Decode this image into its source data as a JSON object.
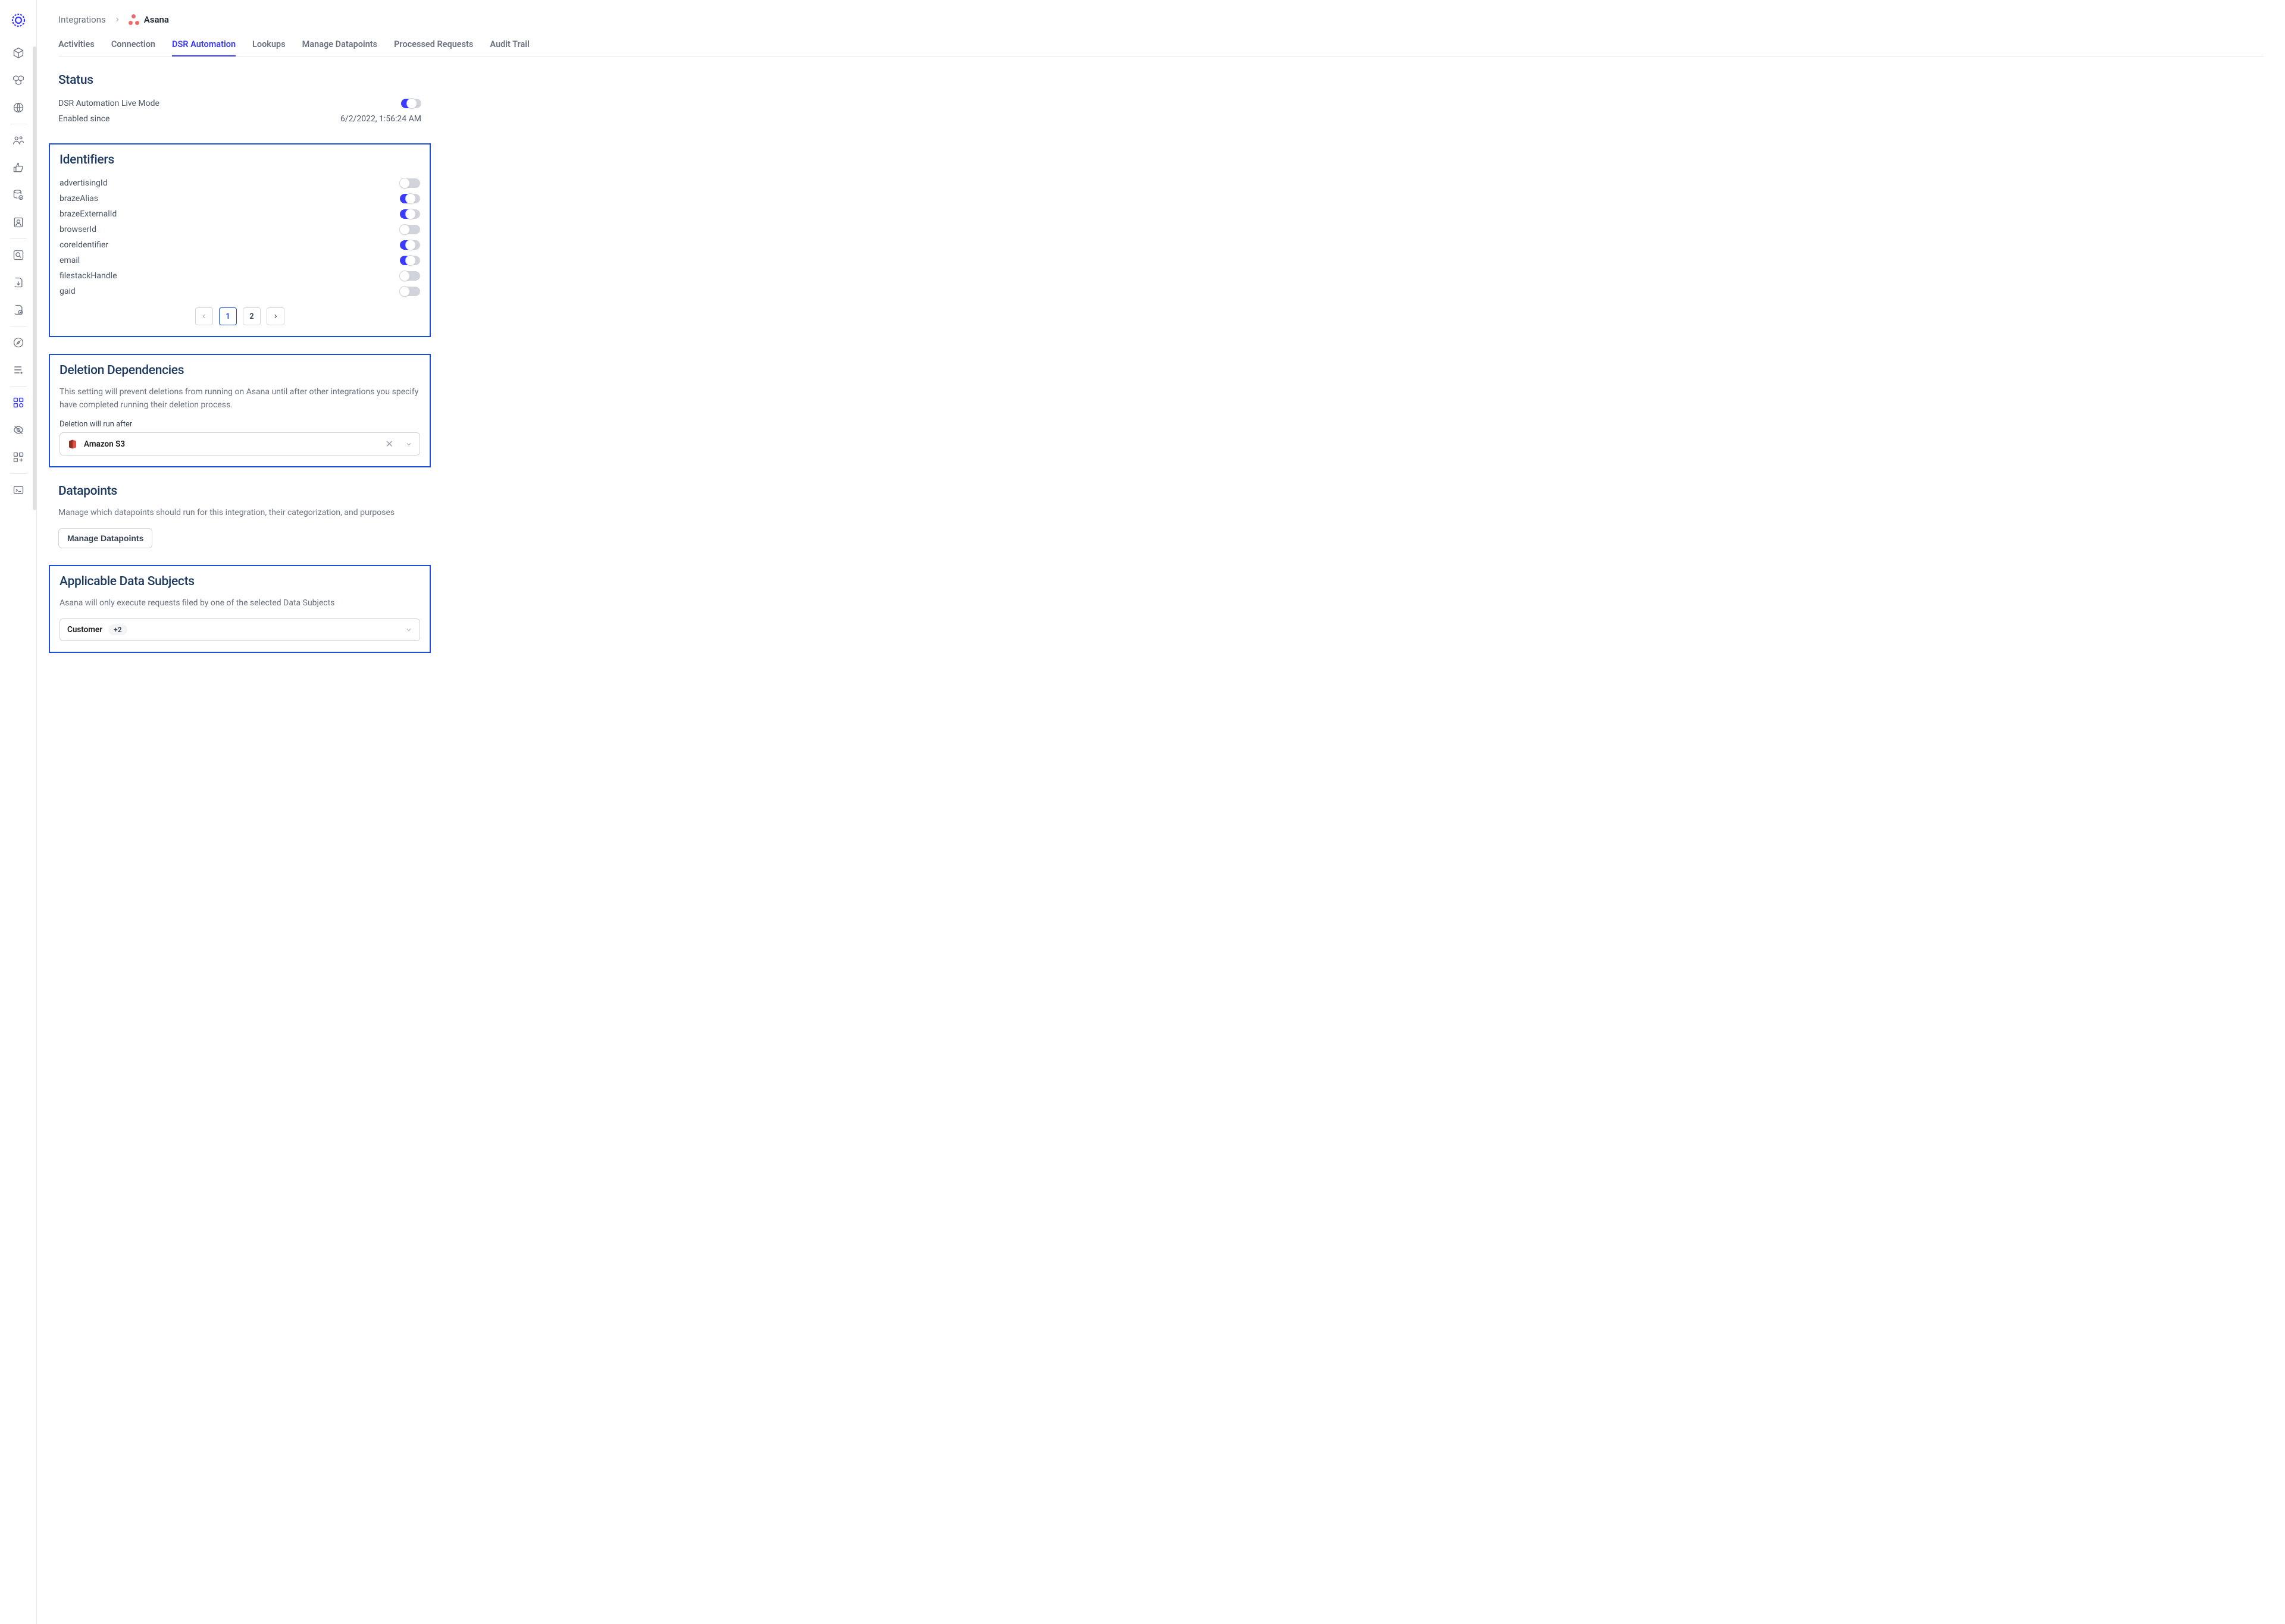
{
  "breadcrumb": {
    "root": "Integrations",
    "current": "Asana"
  },
  "tabs": [
    {
      "label": "Activities"
    },
    {
      "label": "Connection"
    },
    {
      "label": "DSR Automation",
      "active": true
    },
    {
      "label": "Lookups"
    },
    {
      "label": "Manage Datapoints"
    },
    {
      "label": "Processed Requests"
    },
    {
      "label": "Audit Trail"
    }
  ],
  "status": {
    "title": "Status",
    "live_label": "DSR Automation Live Mode",
    "live_on": true,
    "enabled_label": "Enabled since",
    "enabled_value": "6/2/2022, 1:56:24 AM"
  },
  "identifiers": {
    "title": "Identifiers",
    "items": [
      {
        "label": "advertisingId",
        "on": false
      },
      {
        "label": "brazeAlias",
        "on": true
      },
      {
        "label": "brazeExternalId",
        "on": true
      },
      {
        "label": "browserId",
        "on": false
      },
      {
        "label": "coreIdentifier",
        "on": true
      },
      {
        "label": "email",
        "on": true
      },
      {
        "label": "filestackHandle",
        "on": false
      },
      {
        "label": "gaid",
        "on": false
      }
    ],
    "pages": [
      "1",
      "2"
    ],
    "current_page": "1"
  },
  "deletion_deps": {
    "title": "Deletion Dependencies",
    "desc": "This setting will prevent deletions from running on Asana until after other integrations you specify have completed running their deletion process.",
    "field_label": "Deletion will run after",
    "selected": "Amazon S3"
  },
  "datapoints": {
    "title": "Datapoints",
    "desc": "Manage which datapoints should run for this integration, their categorization, and purposes",
    "button": "Manage Datapoints"
  },
  "subjects": {
    "title": "Applicable Data Subjects",
    "desc": "Asana will only execute requests filed by one of the selected Data Subjects",
    "selected": "Customer",
    "extra_count": "+2"
  }
}
